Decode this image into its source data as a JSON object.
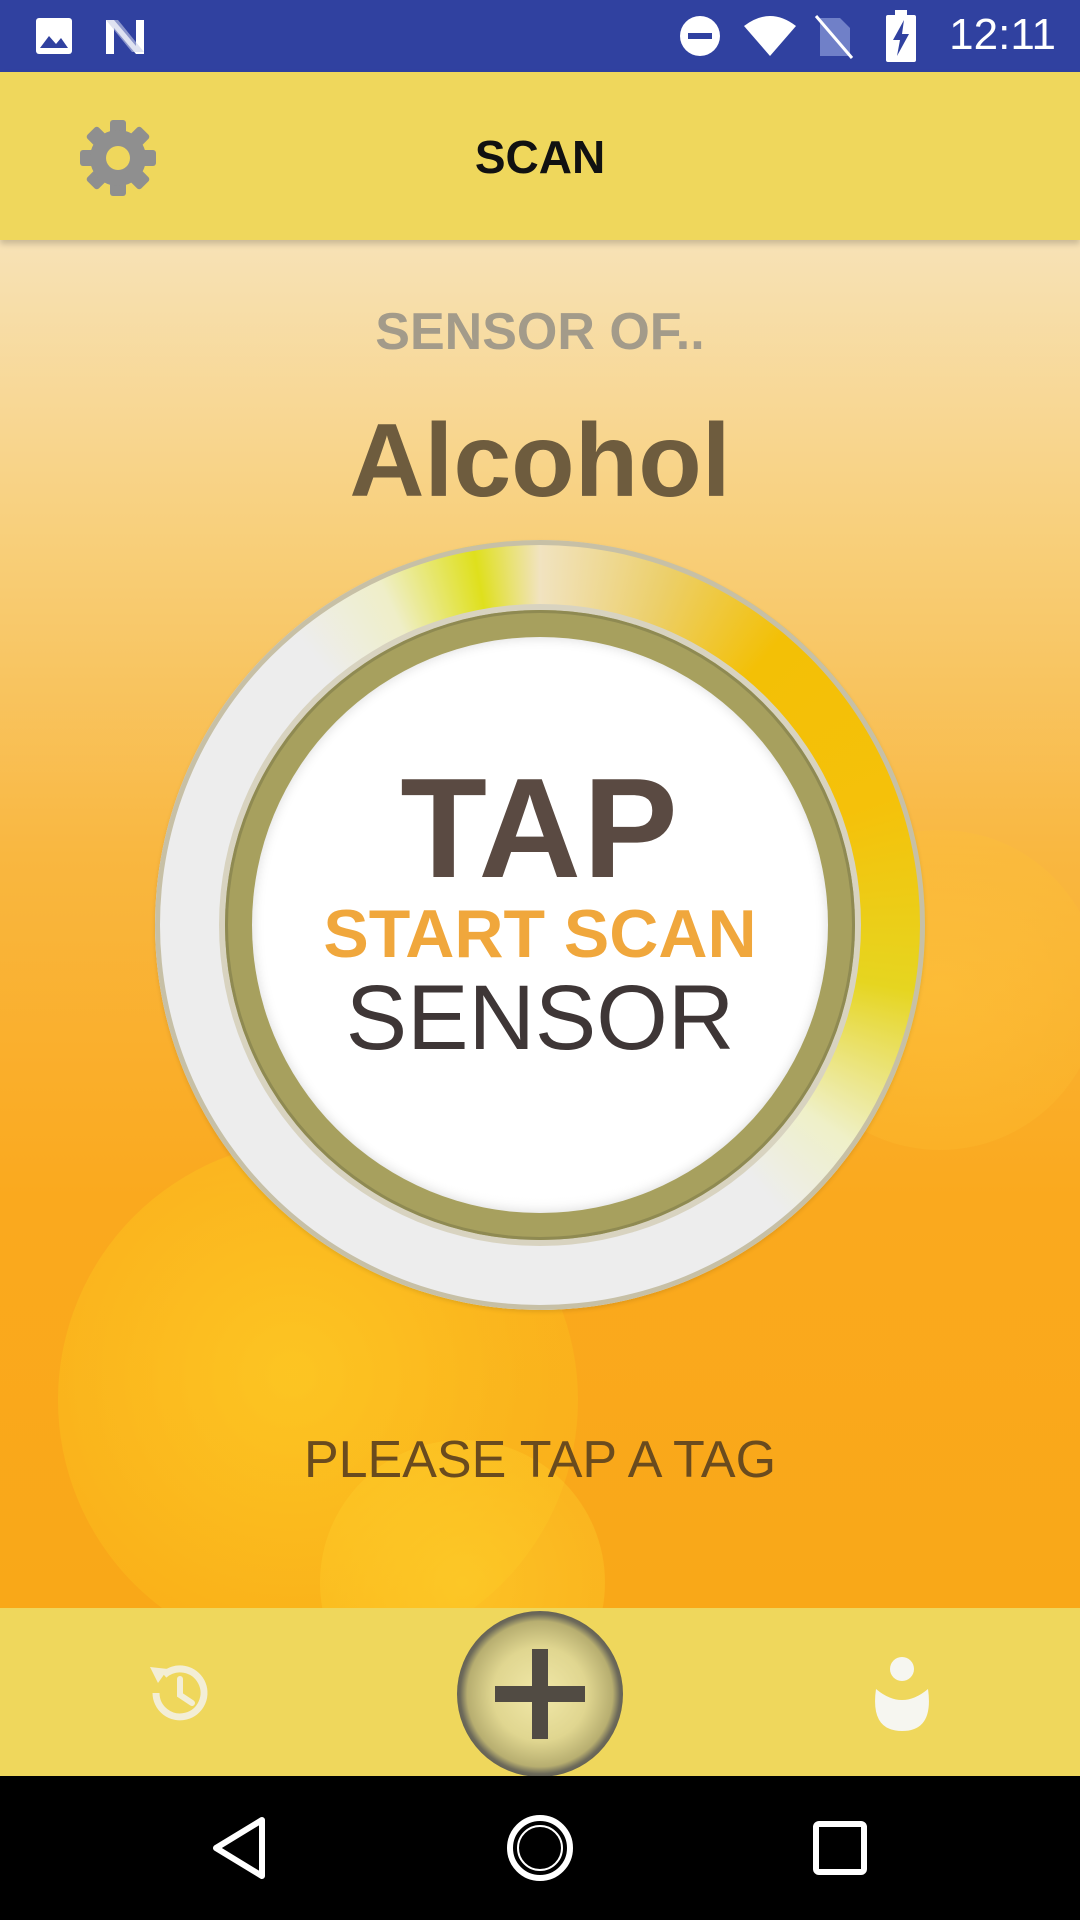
{
  "status_bar": {
    "time": "12:11",
    "icons": [
      "image-icon",
      "n-icon",
      "do-not-disturb-icon",
      "wifi-icon",
      "no-sim-icon",
      "battery-charging-icon"
    ]
  },
  "app_bar": {
    "title": "SCAN",
    "settings_icon": "gear-icon"
  },
  "main": {
    "sensor_of_label": "SENSOR OF..",
    "sensor_name": "Alcohol",
    "dial": {
      "line1": "TAP",
      "line2": "START SCAN",
      "line3": "SENSOR"
    },
    "hint": "PLEASE TAP A TAG"
  },
  "bottom_bar": {
    "items": [
      "history-icon",
      "add-icon",
      "profile-icon"
    ]
  },
  "nav_bar": {
    "items": [
      "back-icon",
      "home-icon",
      "recents-icon"
    ]
  },
  "colors": {
    "status_bar": "#3041a0",
    "app_bar": "#efd75c",
    "accent_orange": "#f0a73c",
    "sensor_name": "#6e5c3e"
  }
}
